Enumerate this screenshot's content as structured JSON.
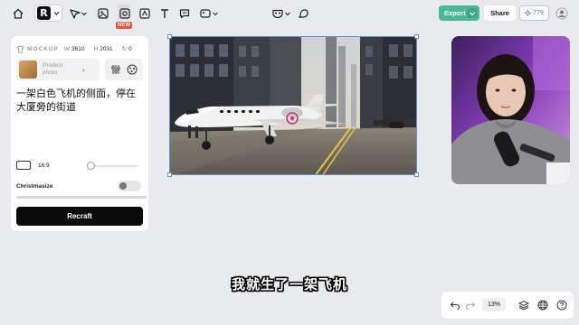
{
  "toolbar": {
    "logo_letter": "R",
    "new_badge": "NEW",
    "export_label": "Export",
    "share_label": "Share",
    "credits_value": "779"
  },
  "panel": {
    "mockup_label": "MOCKUP",
    "width_label": "W",
    "width_value": "3610",
    "height_label": "H",
    "height_value": "2031",
    "rotation_value": "0",
    "product_label": "Product photo",
    "prompt_text": "一架白色飞机的侧面，停在大厦旁的街道",
    "aspect_ratio": "16:9",
    "style_name": "Christmasize",
    "recraft_label": "Recraft"
  },
  "subtitle": "我就生了一架飞机",
  "bottombar": {
    "zoom": "13%"
  },
  "colors": {
    "accent_green": "#4ab895",
    "credits_purple": "#5b5fc7",
    "new_badge": "#e8553b",
    "selection_blue": "#6c8bd0"
  },
  "icons": [
    "home-icon",
    "chevron-down-icon",
    "pointer-icon",
    "image-icon",
    "image-edit-icon",
    "vector-icon",
    "text-icon",
    "comment-icon",
    "image-settings-icon",
    "mask-icon",
    "mouse-icon",
    "adjust-icon",
    "scatter-icon",
    "undo-icon",
    "redo-icon",
    "layers-icon",
    "globe-icon",
    "help-icon"
  ]
}
